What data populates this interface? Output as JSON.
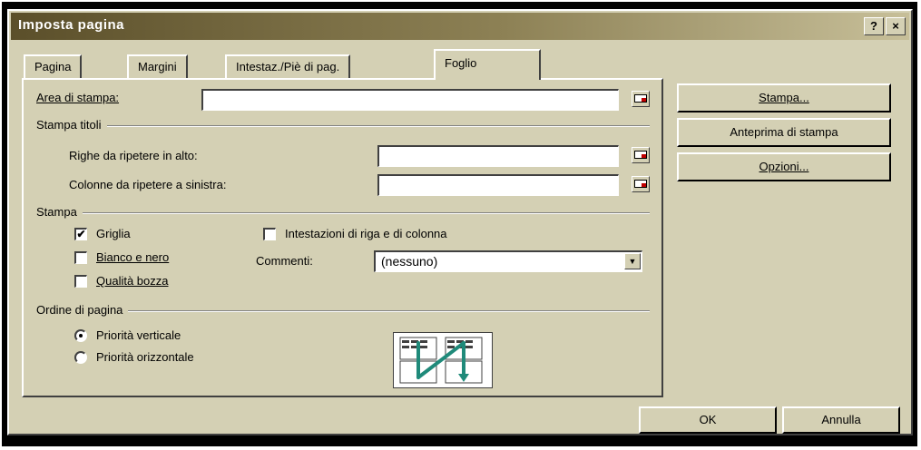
{
  "window": {
    "title": "Imposta pagina",
    "help_glyph": "?",
    "close_glyph": "×"
  },
  "tabs": [
    {
      "label": "Pagina"
    },
    {
      "label": "Margini"
    },
    {
      "label": "Intestaz./Piè di pag."
    },
    {
      "label": "Foglio",
      "active": true
    }
  ],
  "sheet": {
    "print_area_label": "Area di stampa:",
    "print_area_value": "",
    "titles_group": "Stampa titoli",
    "rows_repeat_label": "Righe da ripetere in alto:",
    "rows_repeat_value": "",
    "cols_repeat_label": "Colonne da ripetere a sinistra:",
    "cols_repeat_value": "",
    "print_group": "Stampa",
    "gridlines_label": "Griglia",
    "gridlines_checked": true,
    "bw_label": "Bianco e nero",
    "bw_checked": false,
    "draft_label": "Qualità bozza",
    "draft_checked": false,
    "headings_label": "Intestazioni di riga e di colonna",
    "headings_checked": false,
    "comments_label": "Commenti:",
    "comments_value": "(nessuno)",
    "order_group": "Ordine di pagina",
    "down_then_over_label": "Priorità verticale",
    "down_then_over_selected": true,
    "over_then_down_label": "Priorità orizzontale",
    "over_then_down_selected": false,
    "check_glyph": "✔",
    "dropdown_glyph": "▼"
  },
  "side_buttons": {
    "print": "Stampa...",
    "preview": "Anteprima di stampa",
    "options": "Opzioni..."
  },
  "footer": {
    "ok": "OK",
    "cancel": "Annulla"
  },
  "colors": {
    "dialog_bg": "#d4d0b4",
    "title_gradient_start": "#5b4f2a",
    "arrow_teal": "#1f8a7a"
  }
}
